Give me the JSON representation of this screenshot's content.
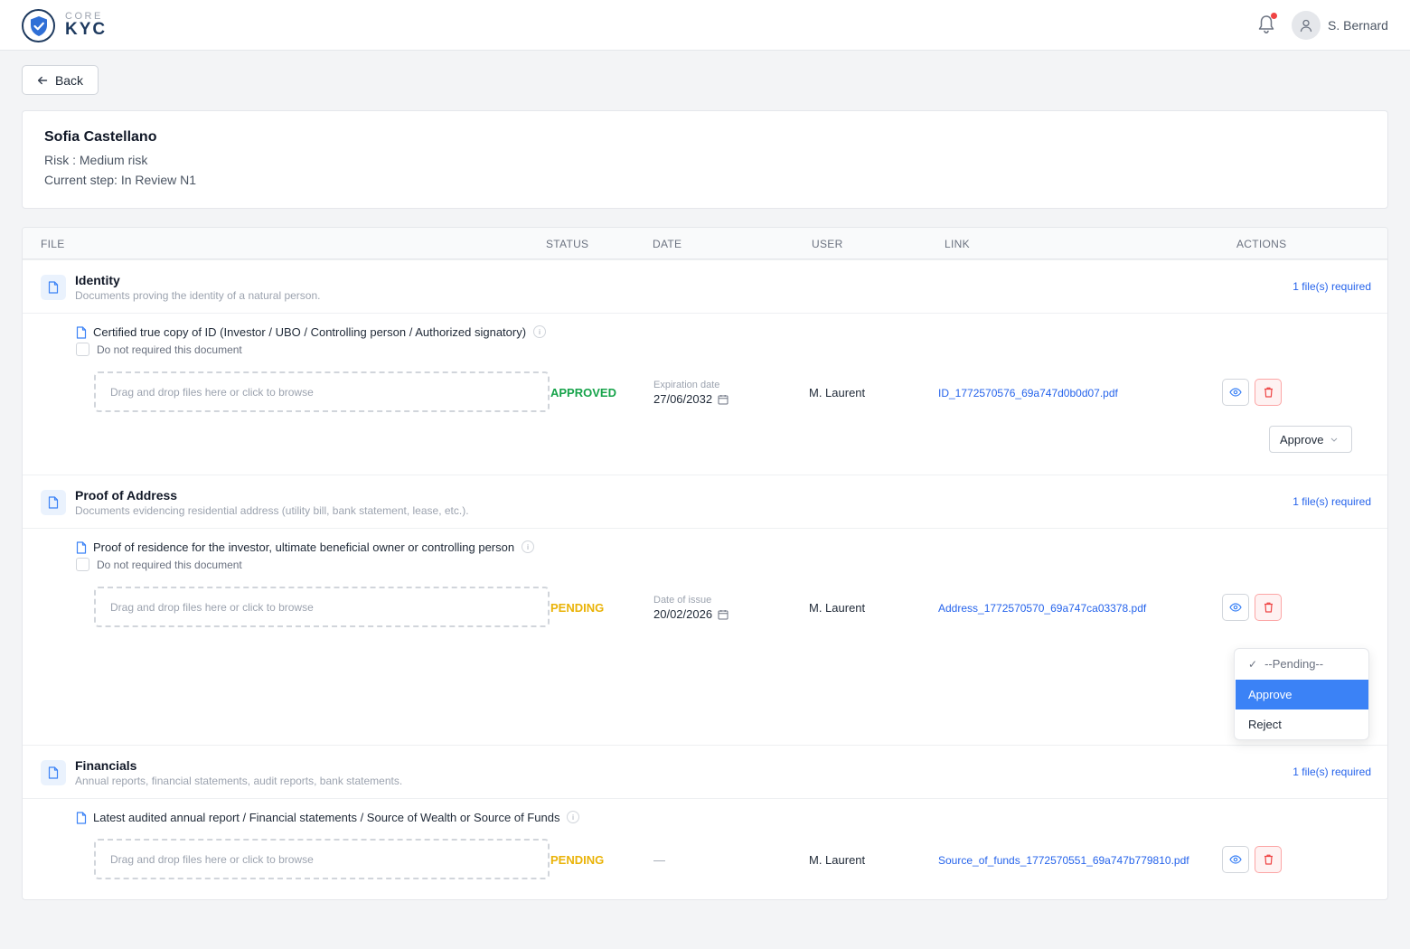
{
  "header": {
    "logo_small": "CORE",
    "logo_big": "KYC",
    "user_name": "S. Bernard",
    "icons": [
      "shield-check-icon",
      "bell-icon",
      "user-icon"
    ]
  },
  "back_label": "Back",
  "client": {
    "name": "Sofia Castellano",
    "risk": "Risk : Medium risk",
    "step": "Current step: In Review N1"
  },
  "table": {
    "headers": [
      "FILE",
      "STATUS",
      "DATE",
      "USER",
      "LINK",
      "ACTIONS"
    ]
  },
  "sections": [
    {
      "title": "Identity",
      "description": "Documents proving the identity of a natural person.",
      "required": "1 file(s) required",
      "document": {
        "title": "Certified true copy of ID (Investor / UBO / Controlling person / Authorized signatory)",
        "not_required_label": "Do not required this document",
        "dropzone": "Drag and drop files here or click to browse",
        "status": "APPROVED",
        "date_label": "Expiration date",
        "date": "27/06/2032",
        "user": "M. Laurent",
        "link": "ID_1772570576_69a747d0b0d07.pdf",
        "select_value": "Approve"
      }
    },
    {
      "title": "Proof of Address",
      "description": "Documents evidencing residential address (utility bill, bank statement, lease, etc.).",
      "required": "1 file(s) required",
      "document": {
        "title": "Proof of residence for the investor, ultimate beneficial owner or controlling person",
        "not_required_label": "Do not required this document",
        "dropzone": "Drag and drop files here or click to browse",
        "status": "PENDING",
        "date_label": "Date of issue",
        "date": "20/02/2026",
        "user": "M. Laurent",
        "link": "Address_1772570570_69a747ca03378.pdf"
      }
    },
    {
      "title": "Financials",
      "description": "Annual reports, financial statements, audit reports, bank statements.",
      "required": "1 file(s) required",
      "document": {
        "title": "Latest audited annual report / Financial statements / Source of Wealth or Source of Funds",
        "dropzone": "Drag and drop files here or click to browse",
        "status": "PENDING",
        "date": "—",
        "user": "M. Laurent",
        "link": "Source_of_funds_1772570551_69a747b779810.pdf"
      }
    }
  ],
  "dropdown": {
    "options": [
      "--Pending--",
      "Approve",
      "Reject"
    ],
    "selected": "--Pending--",
    "highlighted": "Approve"
  },
  "colors": {
    "accent": "#2563eb",
    "approved": "#16a34a",
    "pending": "#eab308",
    "danger": "#ef4444",
    "highlight": "#3b82f6"
  }
}
